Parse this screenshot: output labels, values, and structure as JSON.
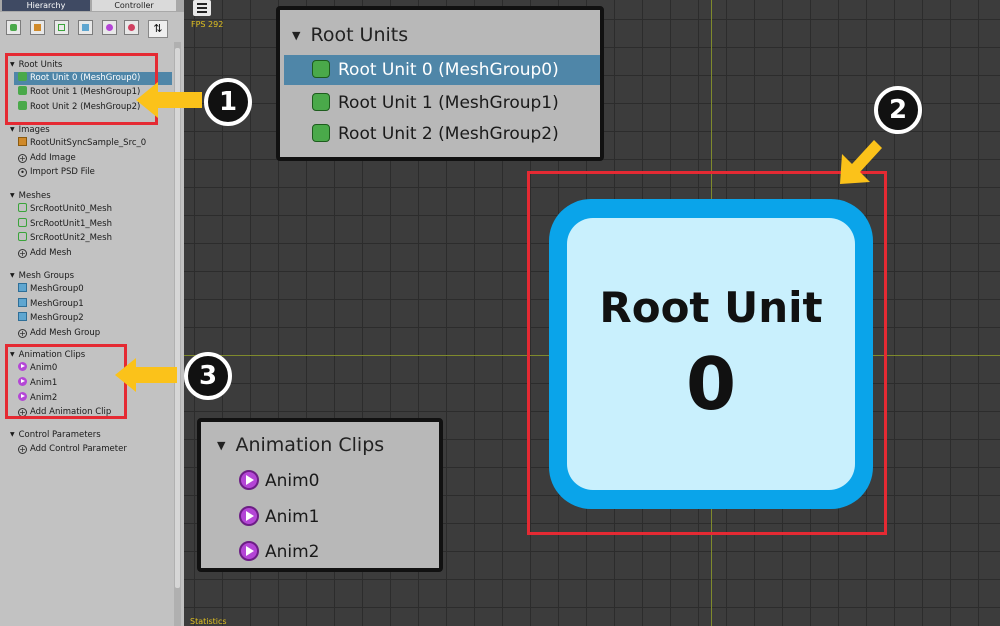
{
  "tabs": {
    "hierarchy": "Hierarchy",
    "controller": "Controller"
  },
  "toolbar": {
    "sort_symbol": "⇅"
  },
  "hierarchy": {
    "root_units": {
      "title": "Root Units",
      "items": [
        "Root Unit 0 (MeshGroup0)",
        "Root Unit 1 (MeshGroup1)",
        "Root Unit 2 (MeshGroup2)"
      ]
    },
    "images": {
      "title": "Images",
      "items": [
        "RootUnitSyncSample_Src_0",
        "Add Image",
        "Import PSD File"
      ]
    },
    "meshes": {
      "title": "Meshes",
      "items": [
        "SrcRootUnit0_Mesh",
        "SrcRootUnit1_Mesh",
        "SrcRootUnit2_Mesh",
        "Add Mesh"
      ]
    },
    "mesh_groups": {
      "title": "Mesh Groups",
      "items": [
        "MeshGroup0",
        "MeshGroup1",
        "MeshGroup2",
        "Add Mesh Group"
      ]
    },
    "animation_clips": {
      "title": "Animation Clips",
      "items": [
        "Anim0",
        "Anim1",
        "Anim2",
        "Add Animation Clip"
      ]
    },
    "control_parameters": {
      "title": "Control Parameters",
      "items": [
        "Add Control Parameter"
      ]
    }
  },
  "viewport": {
    "fps": "FPS 292",
    "statistics": "Statistics"
  },
  "zoom_root_units": {
    "title": "Root Units",
    "items": [
      "Root Unit 0 (MeshGroup0)",
      "Root Unit 1 (MeshGroup1)",
      "Root Unit 2 (MeshGroup2)"
    ]
  },
  "zoom_animation_clips": {
    "title": "Animation Clips",
    "items": [
      "Anim0",
      "Anim1",
      "Anim2"
    ]
  },
  "root_unit_display": {
    "title": "Root Unit",
    "number": "0"
  },
  "callouts": {
    "one": "1",
    "two": "2",
    "three": "3"
  },
  "colors": {
    "highlight": "#e52a33",
    "arrow": "#fbc21a",
    "selection": "#4f86a8",
    "root_unit_frame": "#0aa4ea",
    "root_unit_fill": "#c9f0fd"
  },
  "icons": {
    "root_unit": "root-unit-icon",
    "animation": "animation-clip-icon",
    "add": "add-icon"
  }
}
